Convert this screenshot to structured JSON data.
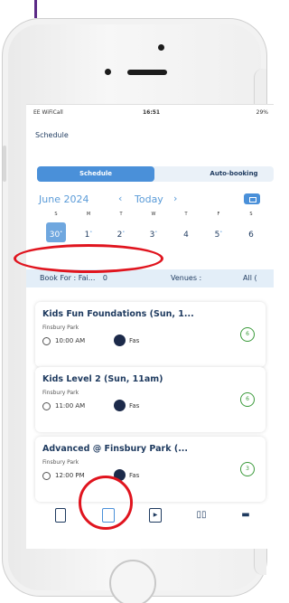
{
  "status_bar": {
    "carrier": "EE WiFiCall",
    "time": "16:51",
    "battery": "29%"
  },
  "header": {
    "title": "Schedule"
  },
  "segmented": {
    "tabs": [
      {
        "label": "Schedule",
        "active": true
      },
      {
        "label": "Auto-booking",
        "active": false
      }
    ]
  },
  "calendar": {
    "month_label": "June 2024",
    "prev_icon": "chevron-left-icon",
    "today_label": "Today",
    "next_icon": "chevron-right-icon",
    "weekdays": [
      "S",
      "M",
      "T",
      "W",
      "T",
      "F",
      "S"
    ],
    "dates": [
      {
        "day": "30",
        "mark": "•",
        "selected": true
      },
      {
        "day": "1",
        "mark": "•",
        "selected": false
      },
      {
        "day": "2",
        "mark": "•",
        "selected": false
      },
      {
        "day": "3",
        "mark": "•",
        "selected": false
      },
      {
        "day": "4",
        "mark": "",
        "selected": false
      },
      {
        "day": "5",
        "mark": "•",
        "selected": false
      },
      {
        "day": "6",
        "mark": "",
        "selected": false
      }
    ]
  },
  "filters": {
    "book_for_label": "Book For :",
    "book_for_value": "Fai...",
    "book_for_count": "0",
    "venues_label": "Venues :",
    "venues_value": "All ("
  },
  "sessions": [
    {
      "title": "Kids Fun Foundations (Sun, 1...",
      "venue": "Finsbury Park",
      "time": "10:00 AM",
      "coach": "Fas",
      "badge": "6"
    },
    {
      "title": "Kids Level 2 (Sun, 11am)",
      "venue": "Finsbury Park",
      "time": "11:00 AM",
      "coach": "Fas",
      "badge": "6"
    },
    {
      "title": "Advanced @ Finsbury Park (...",
      "venue": "Finsbury Park",
      "time": "12:00 PM",
      "coach": "Fas",
      "badge": "3"
    }
  ],
  "tabbar": {
    "items": [
      {
        "name": "document-icon"
      },
      {
        "name": "calendar-icon",
        "active": true
      },
      {
        "name": "play-icon"
      },
      {
        "name": "chart-icon"
      },
      {
        "name": "more-icon"
      }
    ]
  },
  "colors": {
    "accent": "#4a90d9",
    "highlight": "#e0141e",
    "text": "#1e3a5f",
    "badge": "#3a9a3a"
  }
}
